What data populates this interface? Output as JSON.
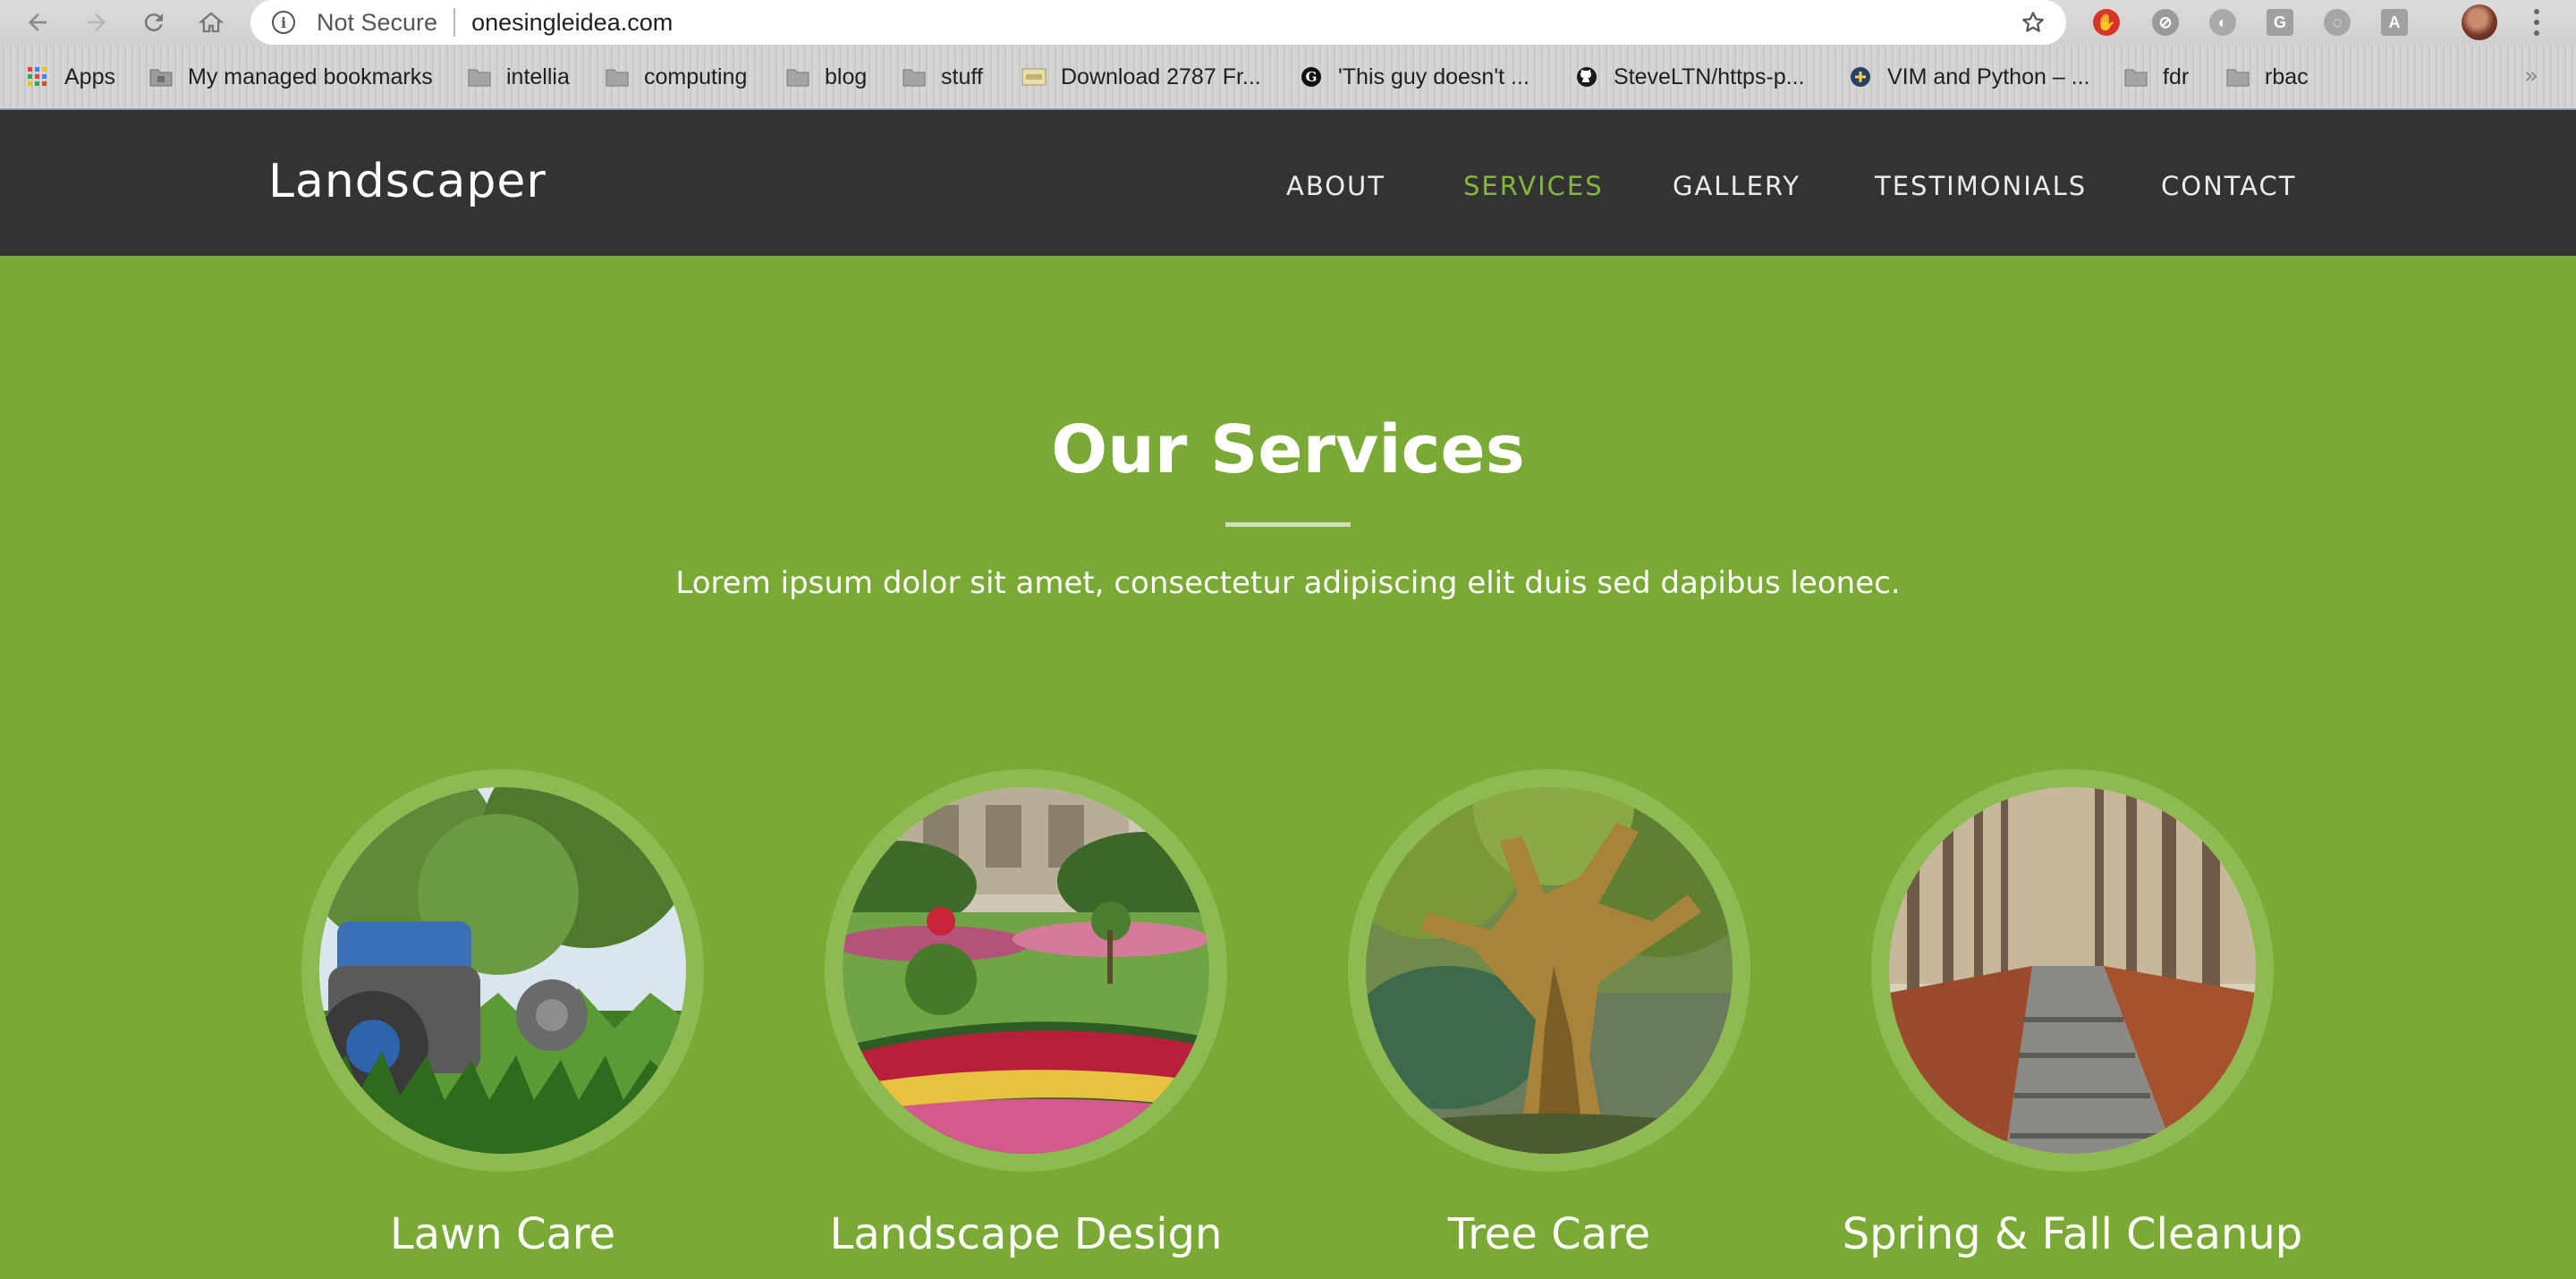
{
  "browser": {
    "security_label": "Not Secure",
    "url": "onesingleidea.com",
    "extensions": [
      "stop-hand-icon",
      "blocked-icon",
      "circle-icon",
      "G",
      "shield-icon",
      "A"
    ]
  },
  "bookmarks": [
    {
      "label": "Apps",
      "icon": "apps-grid-icon"
    },
    {
      "label": "My managed bookmarks",
      "icon": "managed-folder-icon"
    },
    {
      "label": "intellia",
      "icon": "folder-icon"
    },
    {
      "label": "computing",
      "icon": "folder-icon"
    },
    {
      "label": "blog",
      "icon": "folder-icon"
    },
    {
      "label": "stuff",
      "icon": "folder-icon"
    },
    {
      "label": "Download 2787 Fr...",
      "icon": "site-favicon"
    },
    {
      "label": "'This guy doesn't ...",
      "icon": "g-circle-icon"
    },
    {
      "label": "SteveLTN/https-p...",
      "icon": "github-icon"
    },
    {
      "label": "VIM and Python – ...",
      "icon": "python-icon"
    },
    {
      "label": "fdr",
      "icon": "folder-icon"
    },
    {
      "label": "rbac",
      "icon": "folder-icon"
    }
  ],
  "site": {
    "logo": "Landscaper",
    "nav": [
      {
        "label": "ABOUT",
        "active": false
      },
      {
        "label": "SERVICES",
        "active": true
      },
      {
        "label": "GALLERY",
        "active": false
      },
      {
        "label": "TESTIMONIALS",
        "active": false
      },
      {
        "label": "CONTACT",
        "active": false
      }
    ],
    "colors": {
      "header_bg": "#333333",
      "section_bg": "#7aaa35",
      "accent": "#84b83a"
    }
  },
  "services": {
    "title": "Our Services",
    "subtitle": "Lorem ipsum dolor sit amet, consectetur adipiscing elit duis sed dapibus leonec.",
    "items": [
      {
        "label": "Lawn Care",
        "image": "lawn-mower-photo"
      },
      {
        "label": "Landscape Design",
        "image": "garden-flowerbed-photo"
      },
      {
        "label": "Tree Care",
        "image": "old-tree-photo"
      },
      {
        "label": "Spring & Fall Cleanup",
        "image": "autumn-path-photo"
      }
    ]
  }
}
